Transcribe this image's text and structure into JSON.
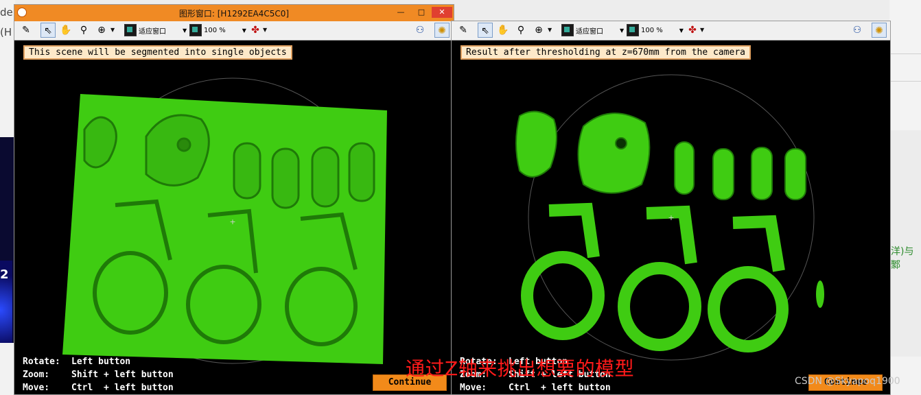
{
  "background": {
    "left_text_1": "de",
    "left_text_2": "(H",
    "left_number": "2",
    "right_text": "洋)与鄹"
  },
  "window1": {
    "title": "图形窗口: [H1292EA4C5C0]",
    "controls": [
      "—",
      "□",
      "✕"
    ],
    "toolbar": {
      "fit_label": "适应窗口",
      "zoom_label": "100 %"
    },
    "message": "This scene will be segmented into single objects",
    "help": [
      {
        "key": "Rotate:",
        "value": "Left button"
      },
      {
        "key": "Zoom:",
        "value": "Shift + left button"
      },
      {
        "key": "Move:",
        "value": "Ctrl  + left button"
      }
    ],
    "continue_label": "Continue"
  },
  "window2": {
    "toolbar": {
      "fit_label": "适应窗口",
      "zoom_label": "100 %"
    },
    "message": "Result after thresholding at z=670mm from the camera",
    "help": [
      {
        "key": "Rotate:",
        "value": "Left button"
      },
      {
        "key": "Zoom:",
        "value": "Shift + left button"
      },
      {
        "key": "Move:",
        "value": "Ctrl  + left button"
      }
    ],
    "continue_label": "Continue"
  },
  "overlay_caption": "通过Z轴来挑出想要的模型",
  "watermark": "CSDN @Skyapoq1900",
  "colors": {
    "accent": "#f08a24",
    "model_green": "#3fcc12",
    "caption_red": "#ff1a1a"
  }
}
